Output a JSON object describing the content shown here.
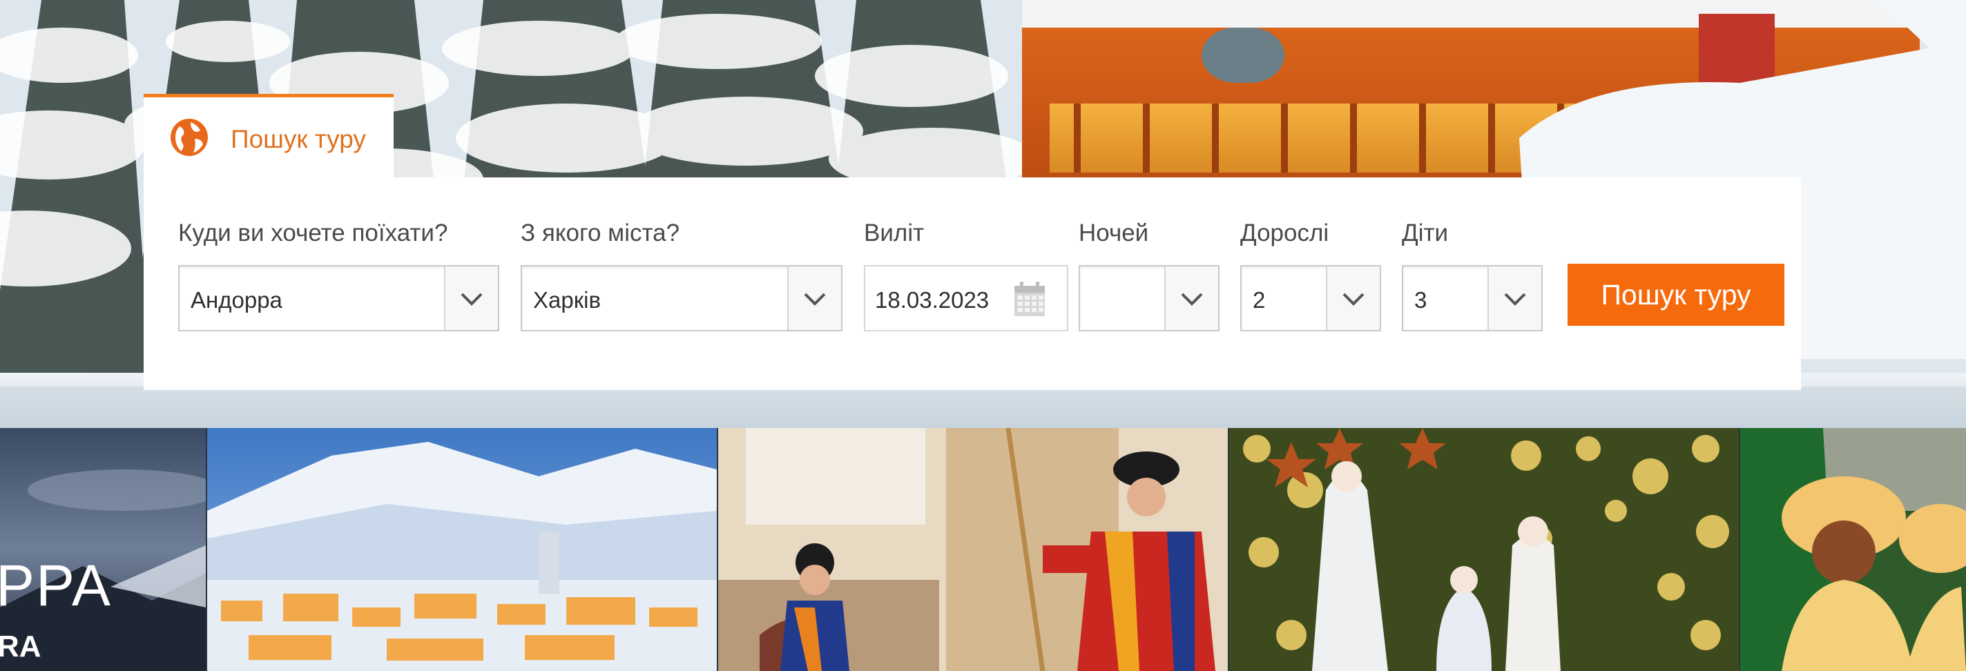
{
  "search_tab": {
    "label": "Пошук туру",
    "icon": "globe-icon"
  },
  "fields": {
    "destination": {
      "label": "Куди ви хочете поїхати?",
      "value": "Андорра"
    },
    "from_city": {
      "label": "З якого міста?",
      "value": "Харків"
    },
    "departure": {
      "label": "Виліт",
      "value": "18.03.2023"
    },
    "nights": {
      "label": "Ночей",
      "value": ""
    },
    "adults": {
      "label": "Дорослі",
      "value": "2"
    },
    "children": {
      "label": "Діти",
      "value": "3"
    }
  },
  "search_button": {
    "label": "Пошук туру"
  },
  "gallery": {
    "first_tile": {
      "caption": "PPA",
      "sub": "RA"
    }
  },
  "colors": {
    "accent": "#f56a0c",
    "tab_text": "#e0711f",
    "label": "#4a4a4a"
  }
}
